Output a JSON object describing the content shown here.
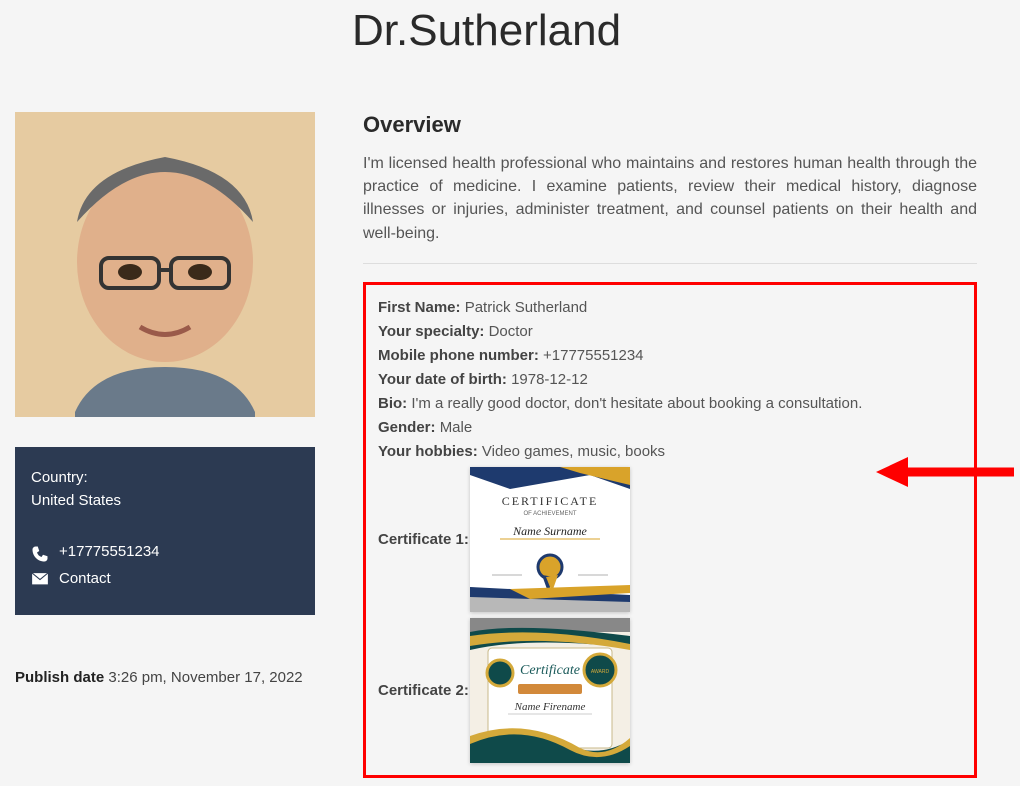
{
  "title": "Dr.Sutherland",
  "overview": {
    "heading": "Overview",
    "text": "I'm licensed health professional who maintains and restores human health through the practice of medicine. I examine patients, review their medical history, diagnose illnesses or injuries, administer treatment, and counsel patients on their health and well-being."
  },
  "details": {
    "first_name_label": "First Name:",
    "first_name_value": "Patrick Sutherland",
    "specialty_label": "Your specialty:",
    "specialty_value": "Doctor",
    "phone_label": "Mobile phone number:",
    "phone_value": "+17775551234",
    "dob_label": "Your date of birth:",
    "dob_value": "1978-12-12",
    "bio_label": "Bio:",
    "bio_value": "I'm a really good doctor, don't hesitate about booking a consultation.",
    "gender_label": "Gender:",
    "gender_value": "Male",
    "hobbies_label": "Your hobbies:",
    "hobbies_value": "Video games, music, books",
    "cert1_label": "Certificate 1:",
    "cert2_label": "Certificate 2:",
    "cert1_title": "CERTIFICATE",
    "cert1_sub": "OF ACHIEVEMENT",
    "cert1_name": "Name Surname",
    "cert2_title": "Certificate",
    "cert2_name": "Name Firename"
  },
  "sidebar": {
    "country_label": "Country:",
    "country_value": "United States",
    "phone": "+17775551234",
    "contact": "Contact"
  },
  "publish": {
    "label": "Publish date",
    "value": "3:26 pm, November 17, 2022"
  }
}
